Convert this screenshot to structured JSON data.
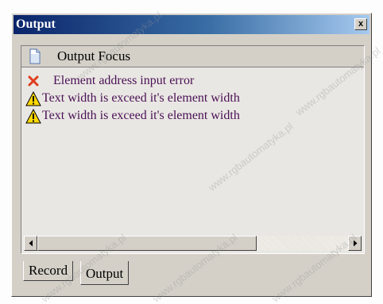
{
  "window": {
    "title": "Output",
    "close_glyph": "x"
  },
  "panel": {
    "header_label": "Output Focus",
    "header_icon": "document-icon"
  },
  "messages": [
    {
      "type": "error",
      "icon": "red-x-icon",
      "text": "Element address input error"
    },
    {
      "type": "warning",
      "icon": "warning-triangle-icon",
      "text": "Text width is exceed it's element width"
    },
    {
      "type": "warning",
      "icon": "warning-triangle-icon",
      "text": "Text width is exceed it's element width"
    }
  ],
  "tabs": [
    {
      "label": "Record",
      "active": false
    },
    {
      "label": "Output",
      "active": true
    }
  ],
  "watermark": "www.rgbautomatyka.pl",
  "colors": {
    "title_gradient_start": "#0a246a",
    "title_gradient_end": "#a6caf0",
    "message_text": "#4a1056",
    "error_red": "#e03c1e",
    "warning_yellow": "#ffd800"
  }
}
